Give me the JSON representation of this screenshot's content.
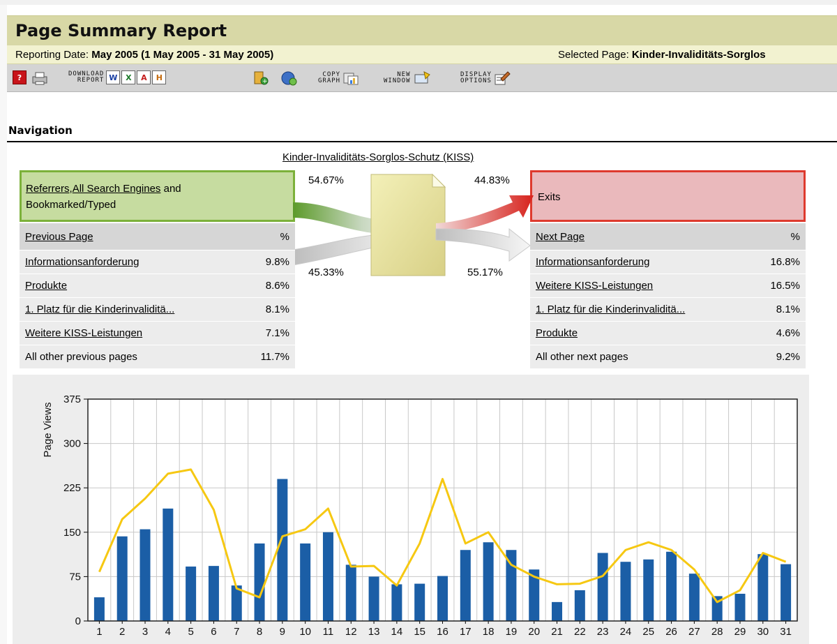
{
  "header": {
    "title": "Page Summary Report",
    "reporting_date_label": "Reporting Date:",
    "reporting_date_value": "May 2005 (1 May 2005 - 31 May 2005)",
    "selected_page_label": "Selected Page:",
    "selected_page_value": "Kinder-Invaliditäts-Sorglos"
  },
  "toolbar": {
    "download_report_label": [
      "DOWNLOAD",
      "REPORT"
    ],
    "copy_graph_label": [
      "COPY",
      "GRAPH"
    ],
    "new_window_label": [
      "NEW",
      "WINDOW"
    ],
    "display_options_label": [
      "DISPLAY",
      "OPTIONS"
    ]
  },
  "navigation": {
    "heading": "Navigation",
    "page_name": "Kinder-Invaliditäts-Sorglos-Schutz (KISS)",
    "referrers_box": {
      "link1": "Referrers",
      "sep": ",",
      "link2": "All Search Engines",
      "rest1": " and",
      "rest2": "Bookmarked/Typed"
    },
    "exits_label": "Exits",
    "pct_entry_from_referrers": "54.67%",
    "pct_entry_from_previous": "45.33%",
    "pct_to_exits": "44.83%",
    "pct_to_next": "55.17%",
    "previous": {
      "header_label": "Previous Page",
      "header_pct": "%",
      "rows": [
        {
          "label": "Informationsanforderung",
          "value": "9.8%"
        },
        {
          "label": "Produkte",
          "value": "8.6%"
        },
        {
          "label": "1. Platz für die Kinderinvaliditä...",
          "value": "8.1%"
        },
        {
          "label": "Weitere KISS-Leistungen",
          "value": "7.1%"
        },
        {
          "label": "All other previous pages",
          "value": "11.7%"
        }
      ]
    },
    "next": {
      "header_label": "Next Page",
      "header_pct": "%",
      "rows": [
        {
          "label": "Informationsanforderung",
          "value": "16.8%"
        },
        {
          "label": "Weitere KISS-Leistungen",
          "value": "16.5%"
        },
        {
          "label": "1. Platz für die Kinderinvaliditä...",
          "value": "8.1%"
        },
        {
          "label": "Produkte",
          "value": "4.6%"
        },
        {
          "label": "All other next pages",
          "value": "9.2%"
        }
      ]
    }
  },
  "colors": {
    "bar": "#1b5ea6",
    "line": "#f6c812",
    "referrers_border": "#7cb13a",
    "exits_border": "#de3a2e"
  },
  "chart_data": {
    "type": "bar",
    "ylabel": "Page Views",
    "xlabel": "",
    "ylim": [
      0,
      375
    ],
    "yticks": [
      0,
      75,
      150,
      225,
      300,
      375
    ],
    "categories": [
      "1",
      "2",
      "3",
      "4",
      "5",
      "6",
      "7",
      "8",
      "9",
      "10",
      "11",
      "12",
      "13",
      "14",
      "15",
      "16",
      "17",
      "18",
      "19",
      "20",
      "21",
      "22",
      "23",
      "24",
      "25",
      "26",
      "27",
      "28",
      "29",
      "30",
      "31"
    ],
    "series": [
      {
        "values": [
          40,
          143,
          155,
          190,
          92,
          93,
          60,
          131,
          240,
          131,
          150,
          95,
          75,
          62,
          63,
          76,
          120,
          133,
          120,
          87,
          32,
          52,
          115,
          100,
          104,
          117,
          80,
          42,
          46,
          113,
          96
        ]
      },
      {
        "values": [
          83,
          172,
          207,
          249,
          256,
          188,
          55,
          40,
          143,
          155,
          190,
          92,
          93,
          60,
          131,
          240,
          131,
          150,
          95,
          75,
          62,
          63,
          76,
          120,
          133,
          120,
          87,
          32,
          52,
          115,
          100
        ]
      }
    ],
    "grid": true
  }
}
